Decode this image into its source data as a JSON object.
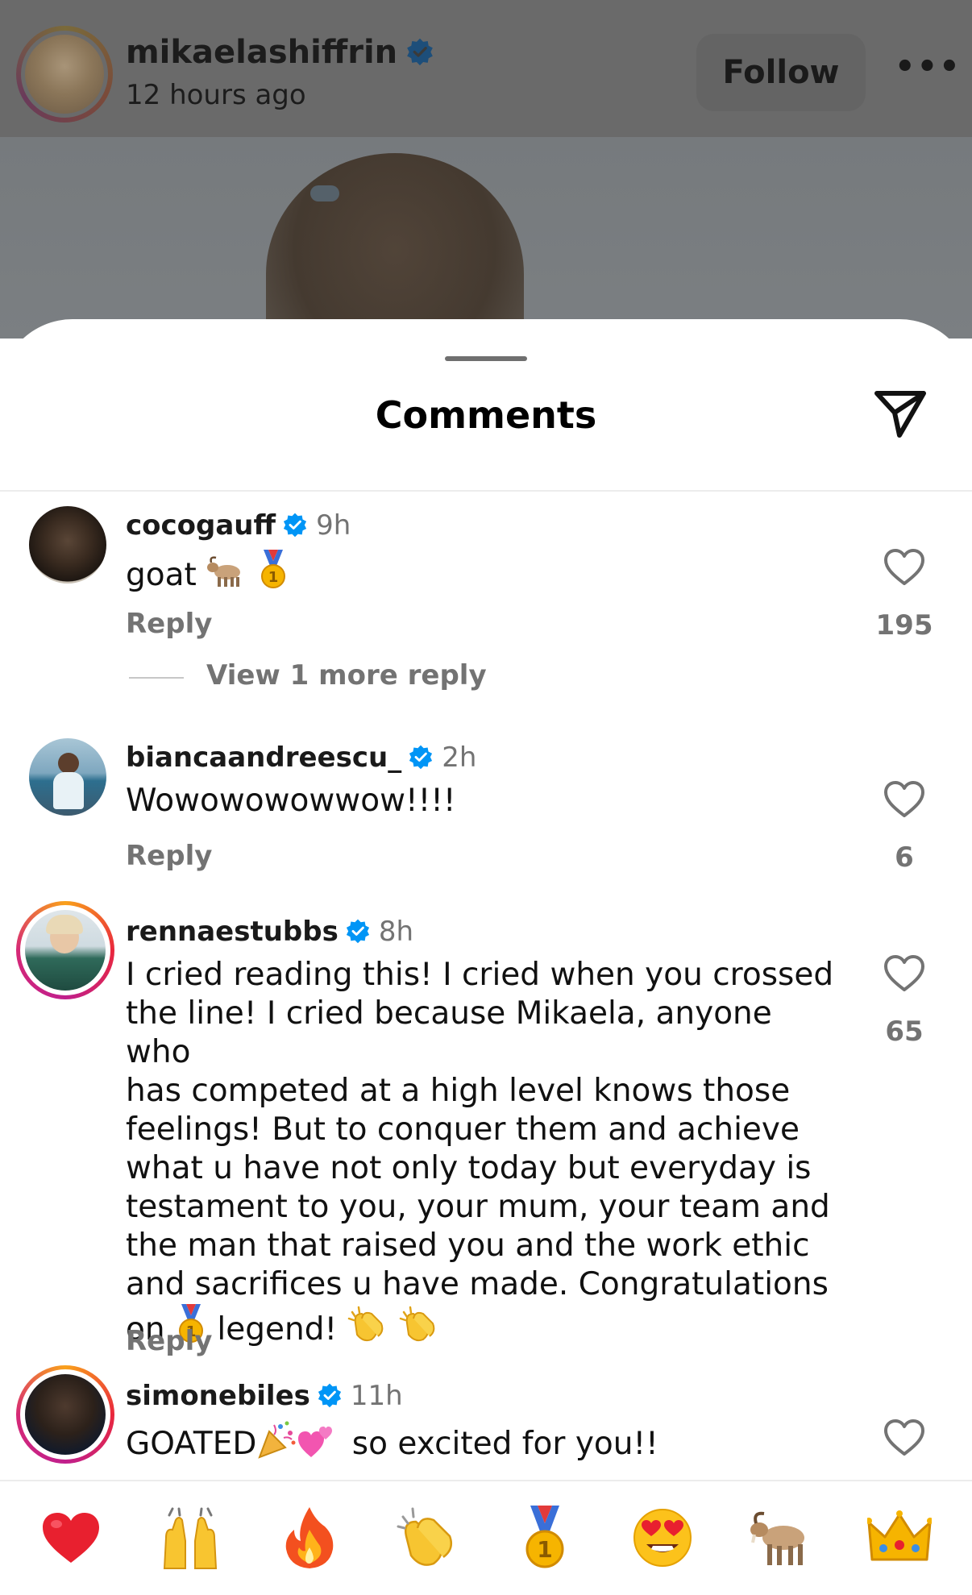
{
  "post": {
    "username": "mikaelashiffrin",
    "time": "12 hours ago",
    "follow_label": "Follow",
    "more_label": "•••"
  },
  "sheet": {
    "title": "Comments"
  },
  "comments": [
    {
      "username": "cocogauff",
      "time": "9h",
      "text": "goat",
      "reply_label": "Reply",
      "likes": "195",
      "more_replies": "View 1 more reply"
    },
    {
      "username": "biancaandreescu_",
      "time": "2h",
      "text": "Wowowowowwow!!!!",
      "reply_label": "Reply",
      "likes": "6"
    },
    {
      "username": "rennaestubbs",
      "time": "8h",
      "lines": [
        "I cried reading this! I cried when you crossed",
        "the line! I cried because Mikaela, anyone who",
        "has competed at a high level knows those",
        "feelings! But to conquer them and achieve",
        "what u have not only today but everyday is",
        "testament to you, your mum, your team and",
        "the man that raised you and the work ethic",
        "and sacrifices u have made. Congratulations"
      ],
      "last_line_a": "on",
      "last_line_b": "legend!",
      "reply_label": "Reply",
      "likes": "65"
    },
    {
      "username": "simonebiles",
      "time": "11h",
      "text_a": "GOATED",
      "text_b": "so excited for you!!"
    }
  ],
  "icons": {
    "verified": "verified-badge-icon",
    "like": "heart-outline-icon",
    "share": "paper-plane-icon"
  },
  "reactions": [
    "heart",
    "raising-hands",
    "fire",
    "clapping-hands",
    "gold-medal",
    "heart-eyes",
    "goat",
    "crown"
  ],
  "colors": {
    "verified_blue": "#0095f6",
    "muted_text": "#737373",
    "story_ring": "#d62976"
  }
}
